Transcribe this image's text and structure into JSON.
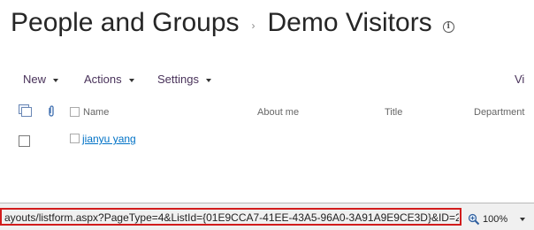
{
  "header": {
    "title": "People and Groups",
    "breadcrumb_separator": "›",
    "subtitle": "Demo Visitors",
    "info_glyph": "i"
  },
  "toolbar": {
    "new_label": "New",
    "actions_label": "Actions",
    "settings_label": "Settings",
    "view_label": "Vi"
  },
  "columns": {
    "name": "Name",
    "about_me": "About me",
    "title": "Title",
    "department": "Department"
  },
  "rows": [
    {
      "name": "jianyu yang"
    }
  ],
  "statusbar": {
    "url": "ayouts/listform.aspx?PageType=4&ListId={01E9CCA7-41EE-43A5-96A0-3A91A9E9CE3D}&ID=2",
    "zoom": "100%"
  },
  "colors": {
    "accent_link": "#0072c6",
    "toolbar_text": "#49325a",
    "highlight_border": "#d21d1d"
  },
  "icons": [
    "info-icon",
    "select-all-icon",
    "attachment-icon",
    "zoom-icon",
    "chevron-down-icon"
  ]
}
